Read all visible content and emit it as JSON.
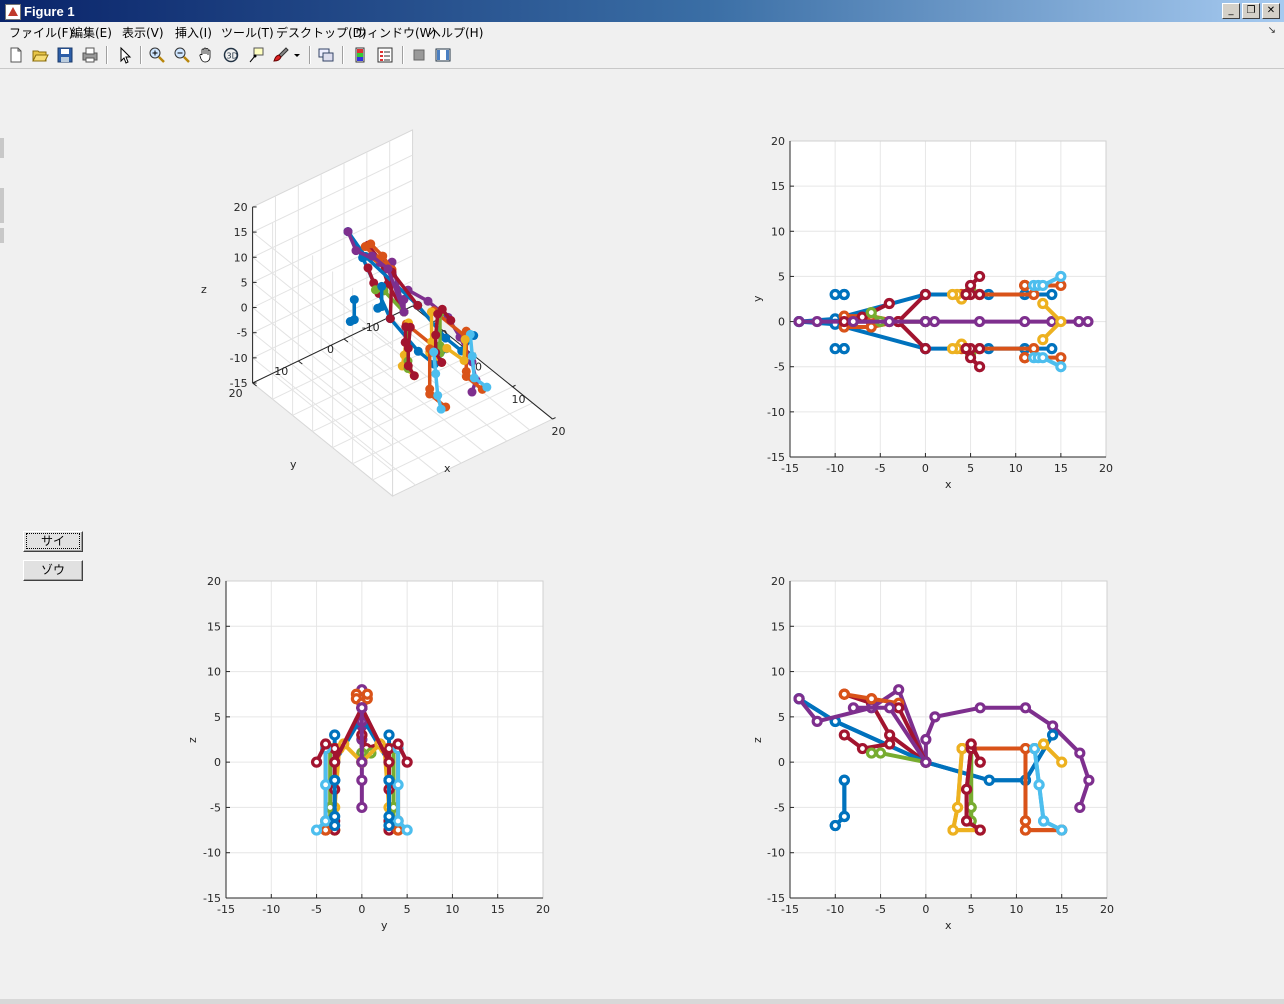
{
  "window": {
    "title": "Figure 1"
  },
  "menu": [
    "ファイル(F)",
    "編集(E)",
    "表示(V)",
    "挿入(I)",
    "ツール(T)",
    "デスクトップ(D)",
    "ウィンドウ(W)",
    "ヘルプ(H)"
  ],
  "toolbar": {
    "icons": [
      "new-figure-icon",
      "open-file-icon",
      "save-icon",
      "print-icon",
      "pointer-icon",
      "zoom-in-icon",
      "zoom-out-icon",
      "pan-icon",
      "rotate-3d-icon",
      "data-cursor-icon",
      "brush-icon",
      "brush-dropdown-icon",
      "link-plot-icon",
      "colorbar-icon",
      "legend-icon",
      "hide-plot-tools-icon",
      "show-plot-tools-icon"
    ]
  },
  "buttons": {
    "b1": "サイ",
    "b2": "ゾウ"
  },
  "colors": {
    "blue": "#0072bd",
    "orange": "#d95319",
    "yellow": "#edb120",
    "purple": "#7e2f8e",
    "green": "#77ac30",
    "cyan": "#4dbeee",
    "red": "#a2142f"
  },
  "chart_data": [
    {
      "type": "line",
      "view": "3d",
      "xlabel": "x",
      "ylabel": "y",
      "zlabel": "z",
      "xticks": [
        "-10",
        "0",
        "10",
        "20"
      ],
      "yticks": [
        "-10",
        "0",
        "10",
        "20"
      ],
      "zticks": [
        "-15",
        "-10",
        "-5",
        "0",
        "5",
        "10",
        "15",
        "20"
      ],
      "xlim": [
        -15,
        20
      ],
      "ylim": [
        -15,
        20
      ],
      "zlim": [
        -15,
        20
      ],
      "grid": true
    },
    {
      "type": "line",
      "view": "xy",
      "xlabel": "x",
      "ylabel": "y",
      "xticks": [
        "-15",
        "-10",
        "-5",
        "0",
        "5",
        "10",
        "15",
        "20"
      ],
      "yticks": [
        "-15",
        "-10",
        "-5",
        "0",
        "5",
        "10",
        "15",
        "20"
      ],
      "xlim": [
        -15,
        20
      ],
      "ylim": [
        -15,
        20
      ],
      "grid": true
    },
    {
      "type": "line",
      "view": "yz",
      "xlabel": "y",
      "ylabel": "z",
      "xticks": [
        "-15",
        "-10",
        "-5",
        "0",
        "5",
        "10",
        "15",
        "20"
      ],
      "yticks": [
        "-15",
        "-10",
        "-5",
        "0",
        "5",
        "10",
        "15",
        "20"
      ],
      "xlim": [
        -15,
        20
      ],
      "ylim": [
        -15,
        20
      ],
      "grid": true
    },
    {
      "type": "line",
      "view": "xz",
      "xlabel": "x",
      "ylabel": "z",
      "xticks": [
        "-15",
        "-10",
        "-5",
        "0",
        "5",
        "10",
        "15",
        "20"
      ],
      "yticks": [
        "-15",
        "-10",
        "-5",
        "0",
        "5",
        "10",
        "15",
        "20"
      ],
      "xlim": [
        -15,
        20
      ],
      "ylim": [
        -15,
        20
      ],
      "grid": true
    }
  ],
  "skeleton": {
    "segments": [
      {
        "c": "purple",
        "pts": [
          [
            17,
            0,
            -5
          ],
          [
            18,
            0,
            -2
          ],
          [
            17,
            0,
            1
          ],
          [
            14,
            0,
            4
          ],
          [
            11,
            0,
            6
          ],
          [
            6,
            0,
            6
          ],
          [
            1,
            0,
            5
          ],
          [
            0,
            0,
            2.5
          ],
          [
            0,
            0,
            0
          ]
        ]
      },
      {
        "c": "red",
        "pts": [
          [
            0,
            0,
            0
          ],
          [
            -4,
            0,
            3
          ],
          [
            -6,
            0,
            6.5
          ],
          [
            -9,
            0,
            7.5
          ]
        ]
      },
      {
        "c": "blue",
        "pts": [
          [
            0,
            3,
            0
          ],
          [
            -10,
            0.3,
            4.5
          ],
          [
            -14,
            0,
            7
          ]
        ]
      },
      {
        "c": "blue",
        "pts": [
          [
            0,
            -3,
            0
          ],
          [
            -10,
            -0.3,
            4.5
          ],
          [
            -14,
            0,
            7
          ]
        ]
      },
      {
        "c": "purple",
        "pts": [
          [
            0,
            0,
            0
          ],
          [
            -3,
            0,
            8
          ],
          [
            -6,
            0,
            6
          ],
          [
            -12,
            0,
            4.5
          ],
          [
            -14,
            0,
            7
          ]
        ]
      },
      {
        "c": "orange",
        "pts": [
          [
            -9,
            -0.6,
            7.5
          ],
          [
            -6,
            -0.6,
            7
          ],
          [
            -3,
            0,
            6.5
          ],
          [
            -6,
            0.6,
            7
          ],
          [
            -9,
            0.6,
            7.5
          ]
        ]
      },
      {
        "c": "red",
        "pts": [
          [
            -4,
            2,
            2
          ],
          [
            -7,
            0.5,
            1.5
          ],
          [
            -9,
            0,
            3
          ]
        ]
      },
      {
        "c": "green",
        "pts": [
          [
            0,
            0,
            0
          ],
          [
            -5,
            0,
            1
          ],
          [
            -6,
            1,
            1
          ]
        ]
      },
      {
        "c": "blue",
        "pts": [
          [
            0,
            3,
            0
          ],
          [
            7,
            3,
            -2
          ],
          [
            11,
            3,
            -2
          ],
          [
            14,
            3,
            3
          ]
        ]
      },
      {
        "c": "blue",
        "pts": [
          [
            0,
            -3,
            0
          ],
          [
            7,
            -3,
            -2
          ],
          [
            11,
            -3,
            -2
          ],
          [
            14,
            -3,
            3
          ]
        ]
      },
      {
        "c": "orange",
        "pts": [
          [
            4,
            3,
            1.5
          ],
          [
            12,
            3,
            1.5
          ]
        ]
      },
      {
        "c": "orange",
        "pts": [
          [
            4,
            -3,
            1.5
          ],
          [
            12,
            -3,
            1.5
          ]
        ]
      },
      {
        "c": "yellow",
        "pts": [
          [
            4,
            2.5,
            1.5
          ],
          [
            3.5,
            3,
            -5
          ],
          [
            3,
            3,
            -7.5
          ],
          [
            6,
            3,
            -7.5
          ]
        ]
      },
      {
        "c": "green",
        "pts": [
          [
            5,
            3.5,
            1.5
          ],
          [
            5,
            3.5,
            -5
          ],
          [
            5,
            3.5,
            -6.5
          ]
        ]
      },
      {
        "c": "red",
        "pts": [
          [
            5,
            3,
            1.5
          ],
          [
            4.5,
            3,
            -3
          ],
          [
            4.5,
            3,
            -6.5
          ],
          [
            6,
            3,
            -7.5
          ]
        ]
      },
      {
        "c": "yellow",
        "pts": [
          [
            4,
            -2.5,
            1.5
          ],
          [
            3.5,
            -3,
            -5
          ],
          [
            3,
            -3,
            -7.5
          ],
          [
            6,
            -3,
            -7.5
          ]
        ]
      },
      {
        "c": "green",
        "pts": [
          [
            5,
            -3.5,
            1.5
          ],
          [
            5,
            -3.5,
            -5
          ],
          [
            5,
            -3.5,
            -6.5
          ]
        ]
      },
      {
        "c": "red",
        "pts": [
          [
            5,
            -3,
            1.5
          ],
          [
            4.5,
            -3,
            -3
          ],
          [
            4.5,
            -3,
            -6.5
          ],
          [
            6,
            -3,
            -7.5
          ]
        ]
      },
      {
        "c": "orange",
        "pts": [
          [
            11,
            4,
            1.5
          ],
          [
            11,
            4,
            -6.5
          ],
          [
            11,
            4,
            -7.5
          ],
          [
            15,
            4,
            -7.5
          ]
        ]
      },
      {
        "c": "cyan",
        "pts": [
          [
            12,
            4,
            1.5
          ],
          [
            12.5,
            4,
            -2.5
          ],
          [
            13,
            4,
            -6.5
          ],
          [
            15,
            5,
            -7.5
          ]
        ]
      },
      {
        "c": "orange",
        "pts": [
          [
            11,
            -4,
            1.5
          ],
          [
            11,
            -4,
            -6.5
          ],
          [
            11,
            -4,
            -7.5
          ],
          [
            15,
            -4,
            -7.5
          ]
        ]
      },
      {
        "c": "cyan",
        "pts": [
          [
            12,
            -4,
            1.5
          ],
          [
            12.5,
            -4,
            -2.5
          ],
          [
            13,
            -4,
            -6.5
          ],
          [
            15,
            -5,
            -7.5
          ]
        ]
      },
      {
        "c": "yellow",
        "pts": [
          [
            13,
            2,
            2
          ],
          [
            15,
            0,
            0
          ],
          [
            13,
            -2,
            2
          ]
        ]
      },
      {
        "c": "red",
        "pts": [
          [
            0,
            3,
            0
          ],
          [
            -3,
            0,
            6
          ],
          [
            0,
            -3,
            0
          ]
        ]
      },
      {
        "c": "purple",
        "pts": [
          [
            0,
            0,
            0
          ],
          [
            -4,
            0,
            6
          ],
          [
            -8,
            0,
            6
          ]
        ]
      },
      {
        "c": "red",
        "pts": [
          [
            5,
            4,
            2
          ],
          [
            6,
            5,
            0
          ]
        ]
      },
      {
        "c": "red",
        "pts": [
          [
            5,
            -4,
            2
          ],
          [
            6,
            -5,
            0
          ]
        ]
      },
      {
        "c": "blue",
        "pts": [
          [
            -9,
            3,
            -2
          ],
          [
            -9,
            3,
            -6
          ],
          [
            -10,
            3,
            -7
          ]
        ]
      },
      {
        "c": "blue",
        "pts": [
          [
            -9,
            -3,
            -2
          ],
          [
            -9,
            -3,
            -6
          ],
          [
            -10,
            -3,
            -7
          ]
        ]
      }
    ]
  }
}
